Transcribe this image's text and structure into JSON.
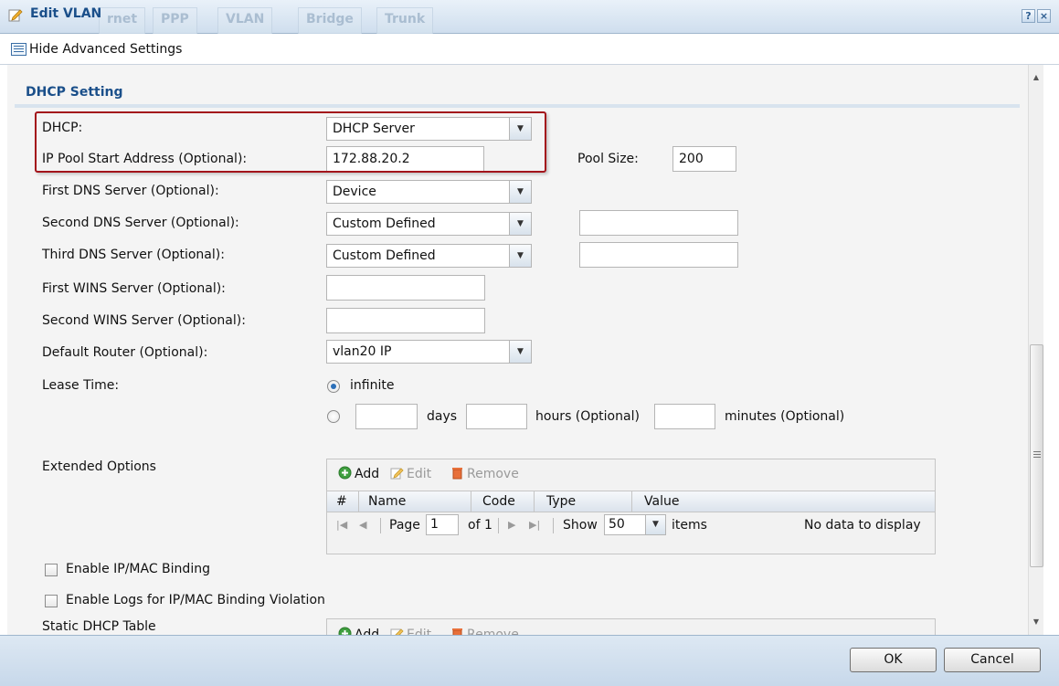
{
  "window": {
    "title": "Edit VLAN",
    "background_tabs": [
      "rnet",
      "PPP",
      "VLAN",
      "Bridge",
      "Trunk"
    ],
    "help_label": "?",
    "close_label": "×"
  },
  "advanced": {
    "label": "Hide Advanced Settings"
  },
  "section": {
    "title": "DHCP Setting"
  },
  "form": {
    "dhcp": {
      "label": "DHCP:",
      "value": "DHCP Server"
    },
    "ip_pool_start": {
      "label": "IP Pool Start Address (Optional):",
      "value": "172.88.20.2"
    },
    "pool_size": {
      "label": "Pool Size:",
      "value": "200"
    },
    "first_dns": {
      "label": "First DNS Server (Optional):",
      "value": "Device"
    },
    "second_dns": {
      "label": "Second DNS Server (Optional):",
      "value": "Custom Defined",
      "custom_value": ""
    },
    "third_dns": {
      "label": "Third DNS Server (Optional):",
      "value": "Custom Defined",
      "custom_value": ""
    },
    "first_wins": {
      "label": "First WINS Server (Optional):",
      "value": ""
    },
    "second_wins": {
      "label": "Second WINS Server (Optional):",
      "value": ""
    },
    "default_router": {
      "label": "Default Router (Optional):",
      "value": "vlan20 IP"
    },
    "lease_time": {
      "label": "Lease Time:",
      "infinite_label": "infinite",
      "days_label": "days",
      "hours_label": "hours (Optional)",
      "minutes_label": "minutes (Optional)",
      "days_value": "",
      "hours_value": "",
      "minutes_value": "",
      "selected": "infinite"
    }
  },
  "extended_options": {
    "label": "Extended Options",
    "toolbar": {
      "add": "Add",
      "edit": "Edit",
      "remove": "Remove"
    },
    "columns": [
      "#",
      "Name",
      "Code",
      "Type",
      "Value"
    ],
    "pager": {
      "page_label": "Page",
      "page_value": "1",
      "of_label": "of 1",
      "show_label": "Show",
      "show_value": "50",
      "items_label": "items",
      "empty_text": "No data to display"
    }
  },
  "ip_mac_binding": {
    "label": "Enable IP/MAC Binding",
    "checked": false
  },
  "binding_logs": {
    "label": "Enable Logs for IP/MAC Binding Violation",
    "checked": false
  },
  "static_dhcp": {
    "label": "Static DHCP Table",
    "toolbar": {
      "add": "Add",
      "edit": "Edit",
      "remove": "Remove"
    }
  },
  "footer": {
    "ok": "OK",
    "cancel": "Cancel"
  },
  "colors": {
    "accent": "#1a4f8a",
    "highlight_border": "#a3141b",
    "footer_bg": "#c7d8ea"
  }
}
